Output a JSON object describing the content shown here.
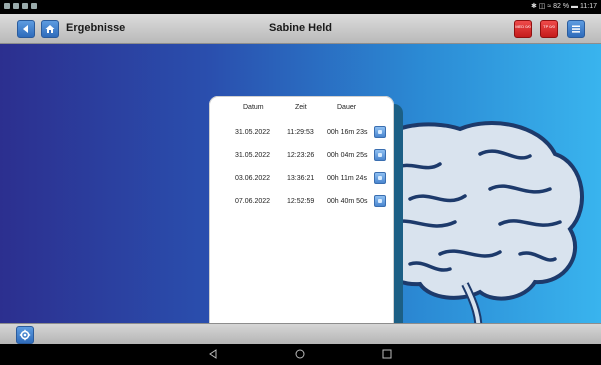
{
  "statusbar": {
    "right_text": "✱ ◫ ≈ 82 % ▬ 11:17"
  },
  "header": {
    "app_title": "Ergebnisse",
    "patient_name": "Sabine Held",
    "red_button_1": "MED 0/0",
    "red_button_2": "TP 0/0"
  },
  "results": {
    "columns": {
      "date": "Datum",
      "time": "Zeit",
      "duration": "Dauer"
    },
    "rows": [
      {
        "date": "31.05.2022",
        "time": "11:29:53",
        "duration": "00h 16m 23s"
      },
      {
        "date": "31.05.2022",
        "time": "12:23:26",
        "duration": "00h 04m 25s"
      },
      {
        "date": "03.06.2022",
        "time": "13:36:21",
        "duration": "00h 11m 24s"
      },
      {
        "date": "07.06.2022",
        "time": "12:52:59",
        "duration": "00h 40m 50s"
      }
    ]
  },
  "icons": {
    "back": "back-arrow-icon",
    "home": "home-icon",
    "menu": "menu-icon",
    "settings": "gear-icon",
    "detail": "detail-icon"
  },
  "colors": {
    "accent_blue": "#2f6bbb",
    "alert_red": "#d42020",
    "background_left": "#2c2f8f",
    "background_right": "#39b4ee"
  }
}
